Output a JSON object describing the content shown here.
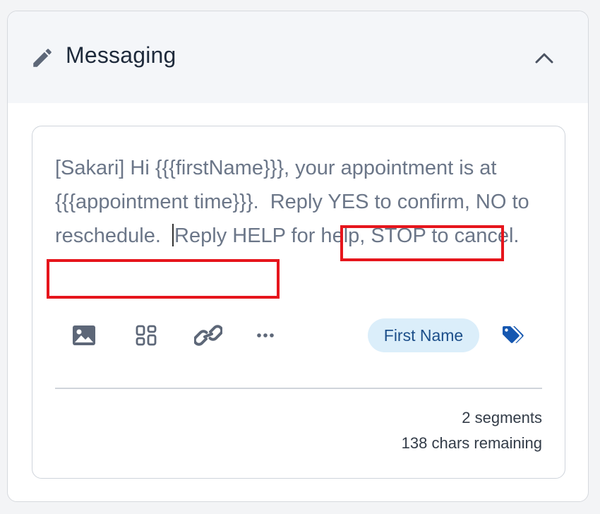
{
  "header": {
    "title": "Messaging",
    "edit_icon": "pencil-icon",
    "collapse_icon": "chevron-up-icon"
  },
  "message": {
    "text_before_caret": "[Sakari] Hi {{{firstName}}}, your appointment is at {{{appointment time}}}.  Reply YES to confirm, NO to reschedule.  ",
    "text_after_caret": "Reply HELP for help, STOP to cancel.",
    "highlight_color": "#e6151c"
  },
  "toolbar": {
    "icons": [
      "image-icon",
      "grid-icon",
      "link-icon",
      "more-icon"
    ],
    "merge_field_label": "First Name",
    "tag_icon": "tag-icon"
  },
  "footer": {
    "segments": "2 segments",
    "chars_remaining": "138 chars remaining"
  },
  "colors": {
    "accent": "#1d4f8a",
    "pill_bg": "#dbeefa",
    "tag_blue": "#1557b0"
  }
}
